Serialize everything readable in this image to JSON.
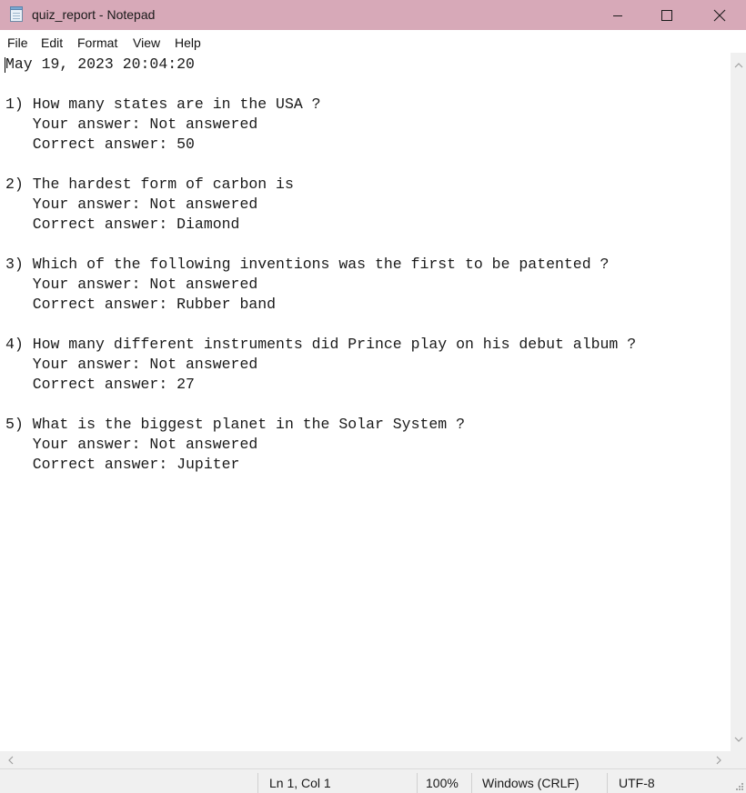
{
  "window": {
    "title": "quiz_report - Notepad",
    "app_icon": "notepad-icon",
    "controls": [
      "minimize-icon",
      "maximize-icon",
      "close-icon"
    ]
  },
  "menu": {
    "file": "File",
    "edit": "Edit",
    "format": "Format",
    "view": "View",
    "help": "Help"
  },
  "document": {
    "lines": [
      "May 19, 2023 20:04:20",
      "",
      "1) How many states are in the USA ?",
      "   Your answer: Not answered",
      "   Correct answer: 50",
      "",
      "2) The hardest form of carbon is",
      "   Your answer: Not answered",
      "   Correct answer: Diamond",
      "",
      "3) Which of the following inventions was the first to be patented ?",
      "   Your answer: Not answered",
      "   Correct answer: Rubber band",
      "",
      "4) How many different instruments did Prince play on his debut album ?",
      "   Your answer: Not answered",
      "   Correct answer: 27",
      "",
      "5) What is the biggest planet in the Solar System ?",
      "   Your answer: Not answered",
      "   Correct answer: Jupiter"
    ]
  },
  "status": {
    "position": "Ln 1, Col 1",
    "zoom": "100%",
    "line_ending": "Windows (CRLF)",
    "encoding": "UTF-8"
  },
  "colors": {
    "titlebar": "#d7a9b8",
    "chrome": "#f0f0f0",
    "text": "#1a1a1a"
  }
}
